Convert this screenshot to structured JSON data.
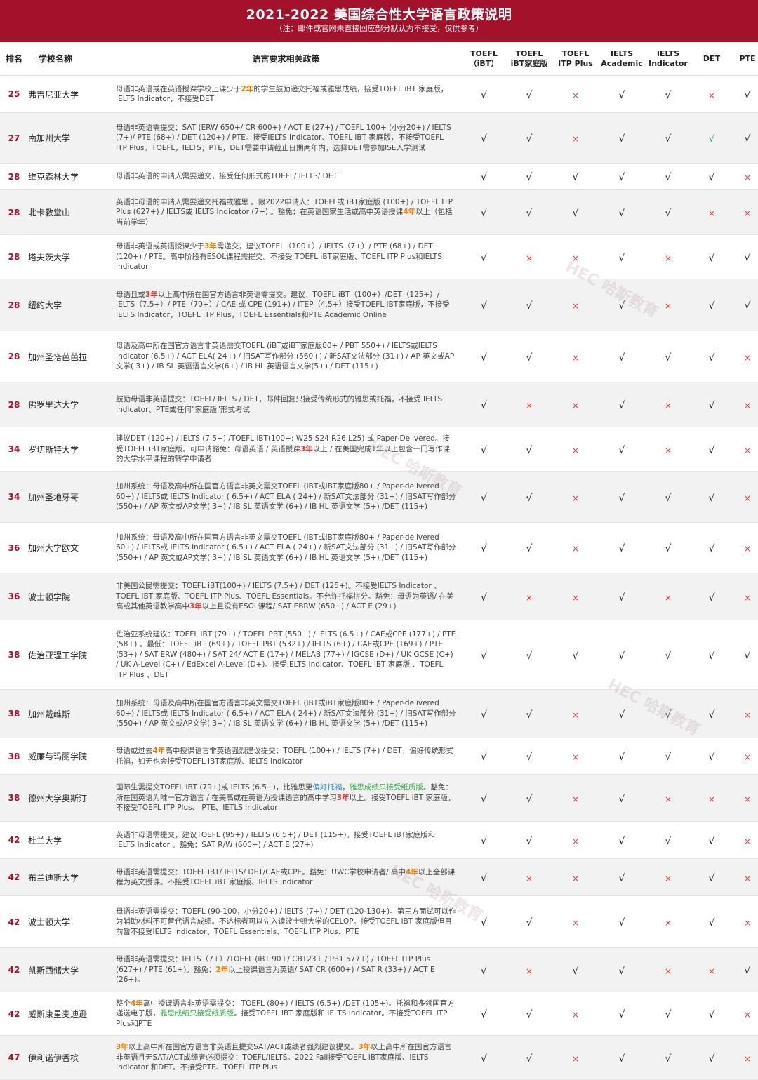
{
  "title": "2021-2022 美国综合性大学语言政策说明",
  "subtitle": "（注：邮件或官网未直接回应部分默认为不接受，仅供参考）",
  "header": {
    "rank": "排名",
    "school": "学校名称",
    "policy": "语言要求相关政策",
    "cols": [
      {
        "l1": "TOEFL",
        "l2": "（iBT）"
      },
      {
        "l1": "TOEFL",
        "l2": "iBT家庭版"
      },
      {
        "l1": "TOEFL",
        "l2": "ITP Plus"
      },
      {
        "l1": "IELTS",
        "l2": "Academic"
      },
      {
        "l1": "IELTS",
        "l2": "Indicator"
      },
      {
        "l1": "DET",
        "l2": ""
      },
      {
        "l1": "PTE",
        "l2": ""
      }
    ]
  },
  "watermark": "HEC 哈斯教育",
  "rows": [
    {
      "rank": "25",
      "school": "弗吉尼亚大学",
      "h": 52,
      "policy": [
        [
          "",
          "母语非英语或在英语授课学校上课少于"
        ],
        [
          "o",
          "2年"
        ],
        [
          "",
          "的学生鼓励递交托福或雅思成绩，接受TOEFL iBT 家庭版，IELTS Indicator，不接受DET"
        ]
      ],
      "marks": [
        "y",
        "y",
        "x",
        "y",
        "y",
        "x",
        "y"
      ]
    },
    {
      "rank": "27",
      "school": "南加州大学",
      "h": 71,
      "policy": [
        [
          "",
          "母语非英语需提交：SAT (ERW 650+/ CR 600+) / ACT E (27+) / TOEFL 100+ (小分20+) / IELTS (7+)/ PTE (68+) / DET (120+) / PTE。接受IELTS Indicator、TOEFL iBT 家庭版，不接受TOEFL ITP Plus。TOEFL，IELTS，PTE，DET需要申请截止日期两年内，选择DET需参加ISE入学测试"
        ]
      ],
      "marks": [
        "y",
        "y",
        "x",
        "y",
        "y",
        "g",
        "y"
      ]
    },
    {
      "rank": "28",
      "school": "维克森林大学",
      "h": 37,
      "policy": [
        [
          "",
          "母语非英语的申请人需要递交，接受任何形式的TOEFL/ IELTS/ DET"
        ]
      ],
      "marks": [
        "y",
        "y",
        "y",
        "y",
        "y",
        "y",
        "x"
      ]
    },
    {
      "rank": "28",
      "school": "北卡教堂山",
      "h": 63,
      "policy": [
        [
          "",
          "英语非母语的申请人需要递交托福或雅思 。限2022申请人：TOEFL或 iBT家庭版 (100+) / TOEFL ITP Plus (627+) / IELTS或 IELTS Indicator (7+) 。豁免：在英语国家生活或高中英语授课"
        ],
        [
          "o",
          "4年"
        ],
        [
          "",
          "以上（包括当前学年）"
        ]
      ],
      "marks": [
        "y",
        "y",
        "y",
        "y",
        "y",
        "x",
        "x"
      ]
    },
    {
      "rank": "28",
      "school": "塔夫茨大学",
      "h": 62,
      "policy": [
        [
          "",
          "母语非英语或英语授课少于"
        ],
        [
          "o",
          "3年"
        ],
        [
          "",
          "需递交，建议TOFEL（100+）/ IELTS（7+）/ PTE (68+) / DET (120+) / PTE。高中阶段有ESOL课程需提交。不接受 TOEFL iBT家庭版、TOEFL ITP Plus和IELTS Indicator"
        ]
      ],
      "marks": [
        "y",
        "x",
        "x",
        "y",
        "x",
        "y",
        "y"
      ]
    },
    {
      "rank": "28",
      "school": "纽约大学",
      "h": 73,
      "policy": [
        [
          "",
          "母语且或"
        ],
        [
          "r",
          "3年"
        ],
        [
          "",
          "以上高中所在国官方语言非英语需提交。建议：TOEFL iBT（100+）/DET（125+）/ IELTS（7.5+）/ PTE（70+）/ CAE 或 CPE (191+) / iTEP（4.5+）接受TOEFL iBT家庭版，不接受 IELTS Indicator，TOEFL ITP Plus，TOEFL Essentials和PTE Academic Online"
        ]
      ],
      "marks": [
        "y",
        "y",
        "x",
        "y",
        "x",
        "y",
        "y"
      ]
    },
    {
      "rank": "28",
      "school": "加州圣塔芭芭拉",
      "h": 72,
      "policy": [
        [
          "",
          "母语及高中所在国官方语言非英语需交TOEFL (iBT或iBT家庭版80+ / PBT 550+) / IELTS或IELTS Indicator (6.5+) / ACT ELA( 24+) / 旧SAT写作部分 (560+) / 新SAT文法部分 (31+) / AP 英文或AP文学( 3+) / IB SL 英语语言文学(6+) / IB HL 英语语言文学(5+) / DET (115+)"
        ]
      ],
      "marks": [
        "y",
        "y",
        "x",
        "y",
        "y",
        "y",
        "x"
      ]
    },
    {
      "rank": "28",
      "school": "佛罗里达大学",
      "h": 63,
      "policy": [
        [
          "",
          "鼓励母语非英语提交：TOEFL/ IELTS / DET，邮件回复只接受传统形式的雅思或托福，不接受 IELTS Indicator、PTE或任何\"家庭版\"形式考试"
        ]
      ],
      "marks": [
        "y",
        "x",
        "x",
        "y",
        "x",
        "y",
        "x"
      ]
    },
    {
      "rank": "34",
      "school": "罗切斯特大学",
      "h": 62,
      "policy": [
        [
          "",
          "建议DET (120+) / IELTS (7.5+) /TOEFL iBT(100+: W25 S24 R26 L25) 或 Paper-Delivered。接受TOEFL iBT家庭版。可申请豁免：母语英语 / 英语授课"
        ],
        [
          "r",
          "3年"
        ],
        [
          "",
          "以上 / 在美国完成1年以上包含一门写作课的大学水平课程的转学申请者"
        ]
      ],
      "marks": [
        "y",
        "y",
        "x",
        "y",
        "x",
        "y",
        "x"
      ]
    },
    {
      "rank": "34",
      "school": "加州圣地牙哥",
      "h": 72,
      "policy": [
        [
          "",
          "加州系统：母语及高中所在国官方语言非英文需交TOEFL (iBT或iBT家庭版80+ / Paper-delivered 60+) / IELTS或 IELTS Indicator ( 6.5+) / ACT ELA ( 24+) / 新SAT文法部分 (31+) / 旧SAT写作部分(550+) / AP 英文或AP文学( 3+) / IB SL 英语文学 (6+) / IB HL 英语文学 (5+) /DET (115+)"
        ]
      ],
      "marks": [
        "y",
        "y",
        "x",
        "y",
        "y",
        "y",
        "x"
      ]
    },
    {
      "rank": "36",
      "school": "加州大学欧文",
      "h": 71,
      "policy": [
        [
          "",
          "加州系统：母语及高中所在国官方语言非英文需交TOEFL (iBT或iBT家庭版80+ / Paper-delivered 60+) / IELTS或 IELTS Indicator ( 6.5+) / ACT ELA ( 24+) / 新SAT文法部分 (31+) / 旧SAT写作部分(550+) / AP 英文或AP文学( 3+) / IB SL 英语文学 (6+) / IB HL 英语文学 (5+) /DET (115+)"
        ]
      ],
      "marks": [
        "y",
        "y",
        "x",
        "y",
        "y",
        "y",
        "x"
      ]
    },
    {
      "rank": "36",
      "school": "波士顿学院",
      "h": 66,
      "policy": [
        [
          "",
          "非美国公民需提交：TOEFL iBT(100+) / IELTS (7.5+) / DET (125+)。不接受IELTS Indicator 、TOEFL iBT 家庭版、TOEFL ITP Plus、TOEFL Essentials。不允许托福拼分。豁免：母语为英语/ 在美高或其他英语教学高中"
        ],
        [
          "r",
          "3年"
        ],
        [
          "",
          "以上且没有ESOL课程/ SAT EBRW (650+) / ACT E (29+)"
        ]
      ],
      "marks": [
        "y",
        "x",
        "x",
        "y",
        "x",
        "y",
        "x"
      ]
    },
    {
      "rank": "38",
      "school": "佐治亚理工学院",
      "h": 98,
      "policy": [
        [
          "",
          "佐治亚系统建议：TOEFL iBT (79+) / TOEFL PBT (550+) / IELTS (6.5+) / CAE或CPE (177+) / PTE (58+) 。最低：TOEFL iBT (69+) / TOEFL PBT (532+) / IELTS (6+) / CAE或CPE (169+) / PTE (53+) / SAT ERW (480+) / SAT 24/ ACT E (17+) / MELAB (77+) / IGCSE (D+) / UK GCSE (C+) / UK A-Level (C+) / EdExcel  A-Level (D+)。接受IELTS Indicator、TOEFL iBT 家庭版 、TOEFL ITP Plus 、DET"
        ]
      ],
      "marks": [
        "y",
        "y",
        "y",
        "y",
        "y",
        "y",
        "y"
      ]
    },
    {
      "rank": "38",
      "school": "加州戴维斯",
      "h": 68,
      "policy": [
        [
          "",
          "加州系统：母语及高中所在国官方语言非英文需交TOEFL (iBT或iBT家庭版80+ / Paper-delivered 60+) / IELTS或 IELTS Indicator ( 6.5+) / ACT ELA ( 24+) / 新SAT文法部分 (31+) / 旧SAT写作部分(550+) / AP 英文或AP文学( 3+) / IB SL 英语文学 (6+) / IB HL 英语文学 (5+) /DET (115+)"
        ]
      ],
      "marks": [
        "y",
        "y",
        "x",
        "y",
        "y",
        "y",
        "x"
      ]
    },
    {
      "rank": "38",
      "school": "威廉与玛丽学院",
      "h": 51,
      "policy": [
        [
          "",
          "母语或过去"
        ],
        [
          "o",
          "4年"
        ],
        [
          "",
          "高中授课语言非英语强烈建议提交：TOEFL (100+) / IELTS (7+) / DET，偏好传统形式托福，如无也会接受TOEFL iBT家庭版、IELTS Indicator"
        ]
      ],
      "marks": [
        "y",
        "y",
        "x",
        "y",
        "y",
        "y",
        "x"
      ]
    },
    {
      "rank": "38",
      "school": "德州大学奥斯汀",
      "h": 66,
      "policy": [
        [
          "",
          "国际生需提交TOEFL iBT (79+)或 IELTS (6.5+)，比雅思更"
        ],
        [
          "b",
          "偏好托福"
        ],
        [
          "",
          "，"
        ],
        [
          "g",
          "雅思成绩只接受纸质版"
        ],
        [
          "",
          "。豁免：所在国英语为唯一官方语言 / 在美高或在英语为授课语言的高中学习"
        ],
        [
          "r",
          "3年"
        ],
        [
          "",
          "以上。接受TOEFL iBT 家庭版，不接受TOEFL ITP Plus、 PTE、IETLS indicator"
        ]
      ],
      "marks": [
        "y",
        "y",
        "x",
        "y",
        "x",
        "x",
        "x"
      ]
    },
    {
      "rank": "42",
      "school": "杜兰大学",
      "h": 52,
      "policy": [
        [
          "",
          "英语非母语需提交，建议TOEFL (95+) / IELTS (6.5+) / DET (115+)。接受TOEFL iBT家庭版和 IELTS Indicator 。豁免：SAT R/W (600+) / ACT E (27+)"
        ]
      ],
      "marks": [
        "y",
        "y",
        "x",
        "y",
        "y",
        "y",
        "x"
      ]
    },
    {
      "rank": "42",
      "school": "布兰迪斯大学",
      "h": 52,
      "policy": [
        [
          "",
          "母语非英语需提交：TOEFL iBT/ IELTS/ DET/CAE或CPE。豁免：UWC学校申请者/ 高中"
        ],
        [
          "o",
          "4年"
        ],
        [
          "",
          "以上全部课程为英文授课。不接受TOEFL iBT 家庭版、IELTS Indicator"
        ]
      ],
      "marks": [
        "y",
        "x",
        "x",
        "y",
        "x",
        "y",
        "x"
      ]
    },
    {
      "rank": "42",
      "school": "波士顿大学",
      "h": 73,
      "policy": [
        [
          "",
          "母语非英语需提交：TOEFL (90-100，小分20+) / IELTS (7+) / DET (120-130+)。第三方面试可以作为辅助材料不可替代语言成绩。不达标者可以先入读波士顿大学的CELOP。接受TOEFL iBT 家庭版但目前暂不接受IELTS Indicator、TOEFL Essentials、TOEFL ITP Plus、PTE"
        ]
      ],
      "marks": [
        "y",
        "y",
        "x",
        "y",
        "x",
        "y",
        "x"
      ]
    },
    {
      "rank": "42",
      "school": "凯斯西储大学",
      "h": 62,
      "policy": [
        [
          "",
          "母语非英语需提交：IELTS（7+）/TOEFL (iBT 90+/ CBT23+ / PBT 577+) / TOEFL ITP Plus (627+) / PTE (61+)。豁免："
        ],
        [
          "o",
          "2年"
        ],
        [
          "",
          "以上授课语言为英语/ SAT CR (600+) / SAT R (33+) / ACT E (26+)。"
        ]
      ],
      "marks": [
        "y",
        "x",
        "y",
        "y",
        "x",
        "x",
        "y"
      ]
    },
    {
      "rank": "42",
      "school": "威斯康星麦迪逊",
      "h": 61,
      "policy": [
        [
          "",
          "整个"
        ],
        [
          "o",
          "4年"
        ],
        [
          "",
          "高中授课语言非英语需提交： TOEFL (80+) / IELTS (6.5+) /DET (105+)。托福和多领国官方递送电子版，"
        ],
        [
          "g",
          "雅思成绩只接受纸质版"
        ],
        [
          "",
          "。接受TOEFL iBT 家庭版和 IELTS Indicator。不接受TOEFL iTP Plus和PTE"
        ]
      ],
      "marks": [
        "y",
        "y",
        "x",
        "y",
        "y",
        "y",
        "x"
      ]
    },
    {
      "rank": "47",
      "school": "伊利诺伊香槟",
      "h": 62,
      "policy": [
        [
          "o",
          "3年"
        ],
        [
          "",
          "以上高中所在国官方语言非英语且提交SAT/ACT成绩者强烈建议提交。"
        ],
        [
          "o",
          "3年"
        ],
        [
          "",
          "以上高中所在国官方语言非英语且无SAT/ACT成绩者必须提交：TOEFL/IELTS。2022 Fall接受TOEFL iBT家庭版、IELTS Indicator 和DET。不接受PTE、TOEFL ITP Plus"
        ]
      ],
      "marks": [
        "y",
        "y",
        "x",
        "y",
        "y",
        "y",
        "x"
      ]
    }
  ],
  "mark_glyphs": {
    "y": "√",
    "x": "×",
    "g": "√"
  },
  "colors": {
    "banner": "#a3122a",
    "rank": "#a3122a",
    "cross": "#e53935",
    "highlight_orange": "#f07b00",
    "highlight_green": "#2fad46",
    "highlight_blue": "#2d7fd0"
  }
}
